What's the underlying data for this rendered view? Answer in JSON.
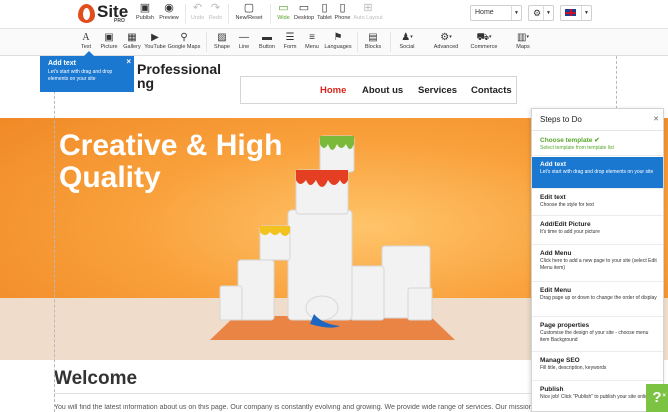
{
  "app": {
    "logo_text": "Site",
    "logo_sub": "PRO"
  },
  "topbar": {
    "publish": "Publish",
    "preview": "Preview",
    "undo": "Undo",
    "redo": "Redo",
    "new_reset": "New/Reset",
    "wide": "Wide",
    "desktop": "Desktop",
    "tablet": "Tablet",
    "phone": "Phone",
    "auto_layout": "Auto Layout",
    "page_select": "Home",
    "flag": "uk-flag"
  },
  "toolbar2": {
    "items": [
      "Text",
      "Picture",
      "Gallery",
      "YouTube",
      "Google Maps",
      "Shape",
      "Line",
      "Button",
      "Form",
      "Menu",
      "Languages",
      "Blocks",
      "Social",
      "Advanced",
      "Commerce",
      "Maps"
    ]
  },
  "site": {
    "brand_line1": "Professional",
    "brand_line2": "ng",
    "nav": [
      "Home",
      "About us",
      "Services",
      "Contacts"
    ],
    "nav_active_color": "#d9261c",
    "hero_title_line1": "Creative & High",
    "hero_title_line2": "Quality",
    "welcome_title": "Welcome",
    "welcome_text": "You will find the latest information about us on this page. Our company is constantly evolving and growing. We provide wide range of services. Our mission is"
  },
  "tooltip": {
    "title": "Add text",
    "desc": "Let's start with drag and drop elements on your site"
  },
  "steps_panel": {
    "title": "Steps to Do",
    "steps": [
      {
        "title": "Choose template",
        "desc": "Select template from template list",
        "state": "done"
      },
      {
        "title": "Add text",
        "desc": "Let's start with drag and drop elements on your site",
        "state": "active"
      },
      {
        "title": "Edit text",
        "desc": "Choose the style for text",
        "state": "todo"
      },
      {
        "title": "Add/Edit Picture",
        "desc": "It's time to add your picture",
        "state": "todo"
      },
      {
        "title": "Add Menu",
        "desc": "Click here to add a new page to your site (select Edit Menu item)",
        "state": "todo"
      },
      {
        "title": "Edit Menu",
        "desc": "Drag page up or down to change the order of display",
        "state": "todo"
      },
      {
        "title": "Page properties",
        "desc": "Customise the design of your site - choose menu item Background",
        "state": "todo"
      },
      {
        "title": "Manage SEO",
        "desc": "Fill title, description, keywords",
        "state": "todo"
      },
      {
        "title": "Publish",
        "desc": "Nice job! Click \"Publish\" to publish your site online",
        "state": "todo"
      }
    ]
  },
  "help": {
    "label": "?"
  },
  "colors": {
    "accent": "#1b78d0",
    "done_green": "#58a72b",
    "hero_orange": "#f9a13c"
  }
}
